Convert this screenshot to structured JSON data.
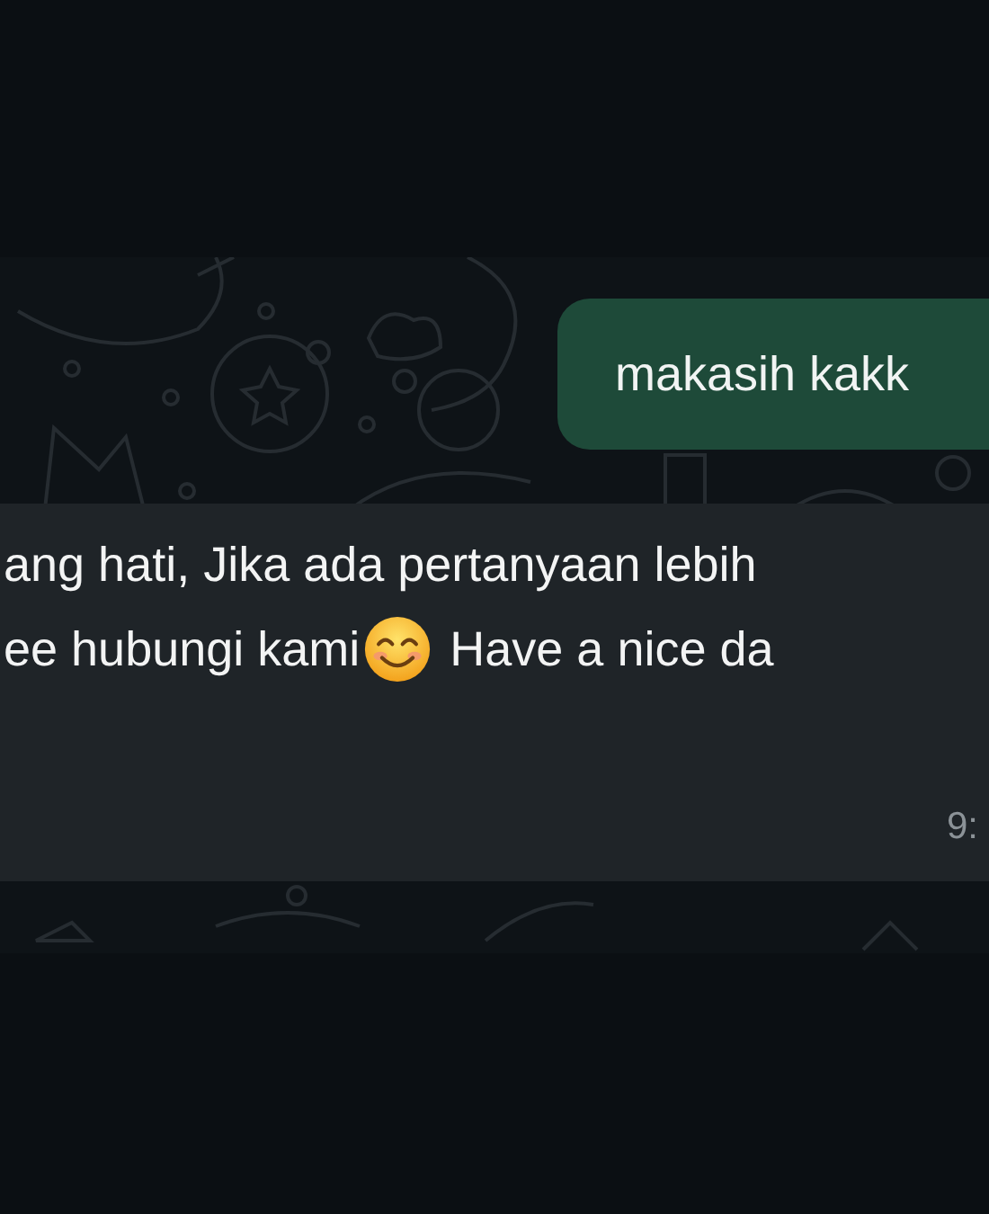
{
  "messages": [
    {
      "kind": "outgoing",
      "text": "makasih kakk"
    },
    {
      "kind": "incoming",
      "line_1": "ang hati, Jika ada pertanyaan lebih",
      "line_2_before_emoji": "ee hubungi kami",
      "line_2_after_emoji": "Have a nice da",
      "time": "9:"
    }
  ]
}
